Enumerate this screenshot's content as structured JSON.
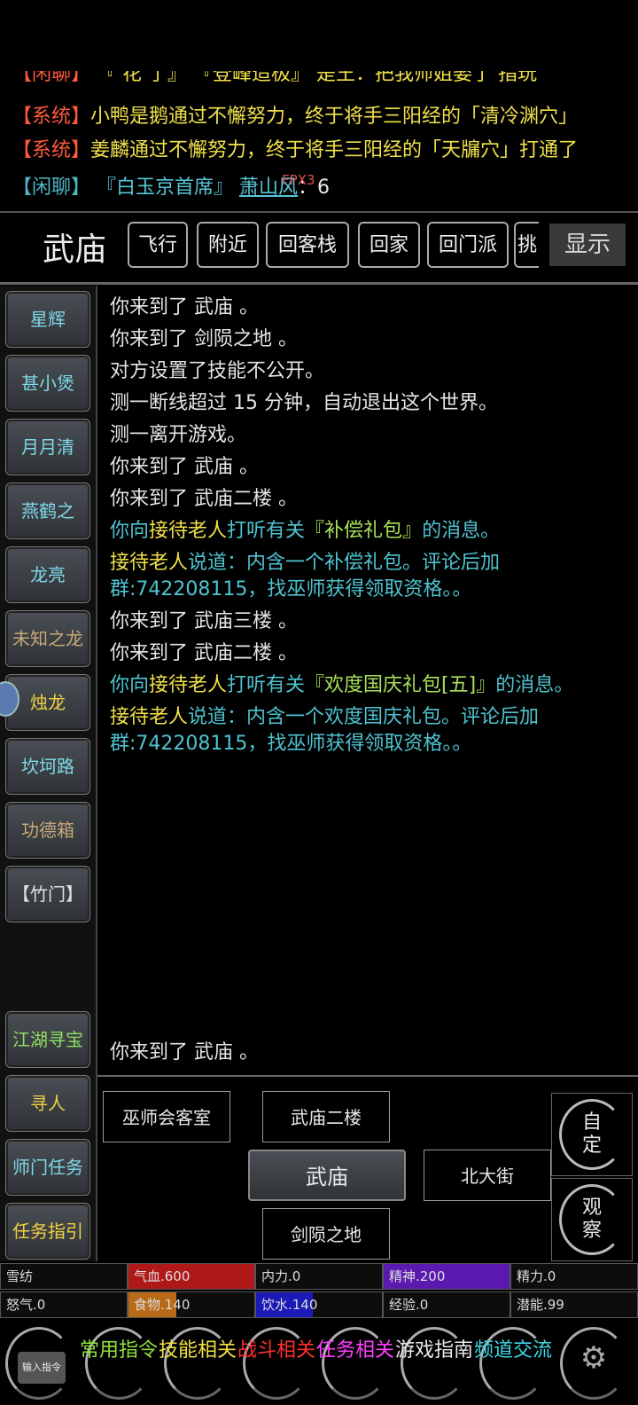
{
  "chat": {
    "line0": {
      "tag": "【闲聊】",
      "text": " 『  花 了』  『登峰造极』 是王：把我师姐娶了 指玩"
    },
    "line1": {
      "tag": "【系统】",
      "text": "小鸭是鹅通过不懈努力，终于将手三阳经的「清冷渊穴」"
    },
    "line2": {
      "tag": "【系统】",
      "text": "姜麟通过不懈努力，终于将手三阳经的「天牖穴」打通了"
    },
    "line3": {
      "tag": "【闲聊】",
      "pre": "『白玉京首席』",
      "name": "萧山风",
      "badge": "FPX3",
      "suffix": "：6"
    }
  },
  "location": {
    "title": "武庙",
    "buttons": [
      "飞行",
      "附近",
      "回客栈",
      "回家",
      "回门派",
      "挑"
    ],
    "show": "显示"
  },
  "npcs": [
    {
      "label": "星辉"
    },
    {
      "label": "甚小煲"
    },
    {
      "label": "月月清"
    },
    {
      "label": "燕鹤之"
    },
    {
      "label": "龙亮"
    },
    {
      "label": "未知之龙"
    },
    {
      "label": "烛龙"
    },
    {
      "label": "坎坷路"
    },
    {
      "label": "功德箱"
    },
    {
      "label": "【竹门】"
    }
  ],
  "shortcuts": [
    "江湖寻宝",
    "寻人",
    "师门任务",
    "任务指引"
  ],
  "log": {
    "l1": "你来到了 武庙 。",
    "l2": "你来到了 剑陨之地 。",
    "l3": "对方设置了技能不公开。",
    "l4": "测一断线超过 15 分钟，自动退出这个世界。",
    "l5": "测一离开游戏。",
    "l6": "你来到了 武庙 。",
    "l7": "你来到了 武庙二楼 。",
    "l8": {
      "a": "你向",
      "b": "接待老人",
      "c": "打听有关",
      "d": "『补偿礼包』",
      "e": "的消息。"
    },
    "l9": {
      "a": "接待老人",
      "b": "说道：内含一个补偿礼包。评论后加群:742208115，找巫师获得领取资格。。"
    },
    "l10": "你来到了 武庙三楼 。",
    "l11": "你来到了 武庙二楼 。",
    "l12": {
      "a": "你向",
      "b": "接待老人",
      "c": "打听有关",
      "d": "『欢度国庆礼包[五]』",
      "e": "的消息。"
    },
    "l13": {
      "a": "接待老人",
      "b": "说道：内含一个欢度国庆礼包。评论后加群:742208115，找巫师获得领取资格。。"
    },
    "bottom": "你来到了 武庙 。"
  },
  "exits": {
    "northwest": "巫师会客室",
    "north": "武庙二楼",
    "center": "武庙",
    "east": "北大街",
    "south": "剑陨之地"
  },
  "side_buttons": {
    "custom": "自定",
    "observe": "观察"
  },
  "stats": {
    "row1": [
      {
        "label": "雪纺",
        "fill": 0,
        "color": "#000000"
      },
      {
        "label": "气血.600",
        "fill": 1.0,
        "color": "#b01818"
      },
      {
        "label": "内力.0",
        "fill": 0,
        "color": "#000000"
      },
      {
        "label": "精神.200",
        "fill": 1.0,
        "color": "#5a1ab0"
      },
      {
        "label": "精力.0",
        "fill": 0,
        "color": "#000000"
      }
    ],
    "row2": [
      {
        "label": "怒气.0",
        "fill": 0,
        "color": "#000000"
      },
      {
        "label": "食物.140",
        "fill": 0.38,
        "color": "#b86a18"
      },
      {
        "label": "饮水.140",
        "fill": 0.45,
        "color": "#1a1ab8"
      },
      {
        "label": "经验.0",
        "fill": 0,
        "color": "#000000"
      },
      {
        "label": "潜能.99",
        "fill": 0,
        "color": "#000000"
      }
    ]
  },
  "bottombar": {
    "input": "输入指令",
    "items": [
      {
        "label": "常用指令",
        "color": "#8fe040"
      },
      {
        "label": "技能相关",
        "color": "#f0e040"
      },
      {
        "label": "战斗相关",
        "color": "#ff3030"
      },
      {
        "label": "任务相关",
        "color": "#ff40ff"
      },
      {
        "label": "游戏指南",
        "color": "#e8e8e8"
      },
      {
        "label": "频道交流",
        "color": "#40d8e8"
      }
    ]
  }
}
